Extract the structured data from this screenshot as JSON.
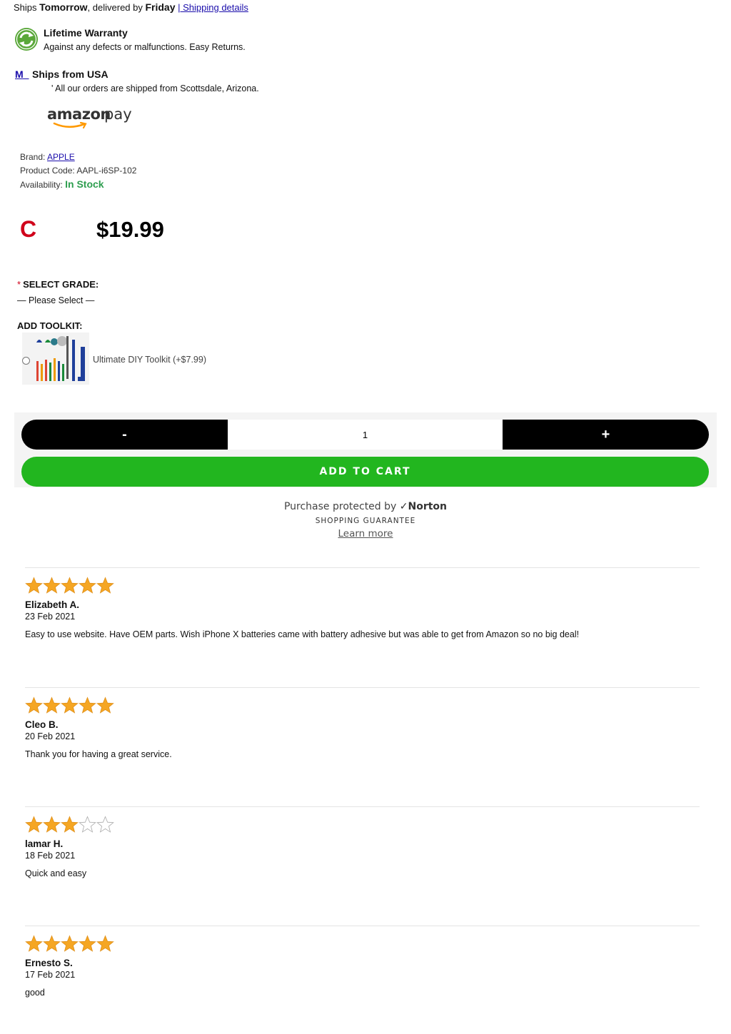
{
  "shipping": {
    "ships_prefix": "Ships ",
    "ships_day": "Tomorrow",
    "delivered_prefix": ", delivered by ",
    "delivered_day": "Friday",
    "details_link": "| Shipping details"
  },
  "warranty": {
    "title": "Lifetime Warranty",
    "subtitle": "Against any defects or malfunctions. Easy Returns."
  },
  "origin": {
    "flag_link": "M_",
    "title": "Ships from USA",
    "subtitle": "' All our orders are shipped from Scottsdale, Arizona."
  },
  "payment": {
    "logo_text_1": "amazon",
    "logo_text_2": "pay"
  },
  "product": {
    "brand_label": "Brand: ",
    "brand_value": "APPLE",
    "code_label": "Product Code: ",
    "code_value": "AAPL-i6SP-102",
    "availability_label": "Availability: ",
    "availability_value": "In Stock",
    "grade_letter": "C",
    "price": "$19.99"
  },
  "options": {
    "required_mark": "*",
    "grade_label": "SELECT GRADE:",
    "grade_placeholder": "— Please Select —",
    "toolkit_label": "ADD TOOLKIT:",
    "toolkit_option": "Ultimate DIY Toolkit (+$7.99)"
  },
  "cart": {
    "minus_label": "-",
    "quantity": "1",
    "plus_label": "+",
    "add_to_cart_label": "ADD TO CART"
  },
  "norton": {
    "prefix": "Purchase protected by ",
    "brand": "Norton",
    "tagline": "SHOPPING GUARANTEE",
    "learn_more": "Learn more"
  },
  "colors": {
    "accent_green": "#22b61f",
    "in_stock_green": "#2e9e4f",
    "grade_red": "#d0021b",
    "star_gold": "#f5a623",
    "link_blue": "#1a0dab"
  },
  "reviews": [
    {
      "rating": 5,
      "name": "Elizabeth A.",
      "date": "23 Feb 2021",
      "text": "Easy to use website. Have OEM parts. Wish iPhone X batteries came with battery adhesive but was able to get from Amazon so no big deal!"
    },
    {
      "rating": 5,
      "name": "Cleo B.",
      "date": "20 Feb 2021",
      "text": "Thank you for having a great service."
    },
    {
      "rating": 3,
      "name": "lamar H.",
      "date": "18 Feb 2021",
      "text": "Quick and easy"
    },
    {
      "rating": 5,
      "name": "Ernesto S.",
      "date": "17 Feb 2021",
      "text": "good"
    }
  ]
}
